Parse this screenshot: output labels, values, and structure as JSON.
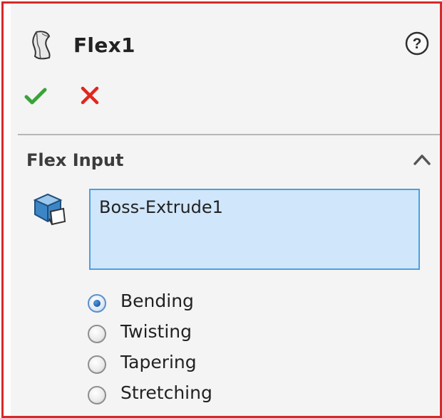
{
  "header": {
    "title": "Flex1",
    "feature_icon": "flex-feature-icon",
    "help_icon": "help-icon"
  },
  "actions": {
    "ok_icon": "checkmark-icon",
    "cancel_icon": "x-icon",
    "ok_color": "#3aa33a",
    "cancel_color": "#e0261d"
  },
  "section": {
    "title": "Flex Input",
    "collapse_icon": "chevron-up-icon",
    "selection_icon": "solid-body-icon",
    "selection_items": [
      "Boss-Extrude1"
    ],
    "selection_bg": "#cfe6fb",
    "selection_border": "#4e9fe0"
  },
  "options": [
    {
      "label": "Bending",
      "checked": true
    },
    {
      "label": "Twisting",
      "checked": false
    },
    {
      "label": "Tapering",
      "checked": false
    },
    {
      "label": "Stretching",
      "checked": false
    }
  ],
  "frame_color": "#d42a2a"
}
